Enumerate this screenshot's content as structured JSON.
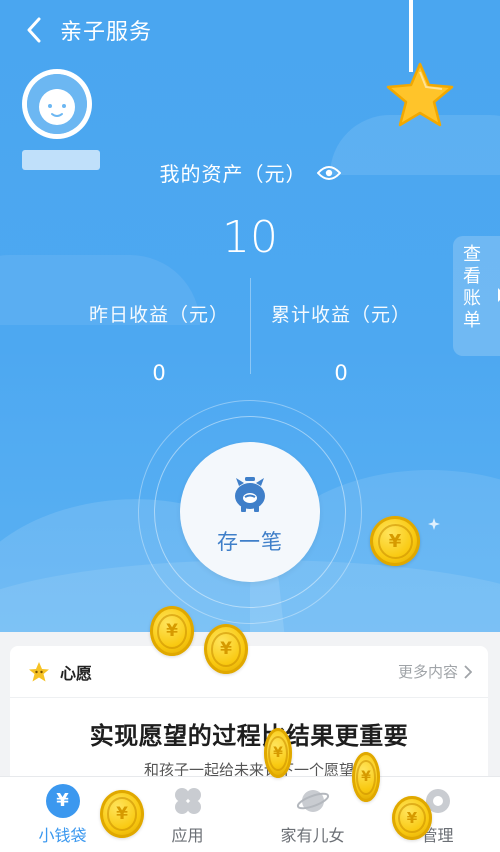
{
  "header": {
    "title": "亲子服务"
  },
  "assets": {
    "label": "我的资产（元）",
    "value": "10",
    "yesterday_label": "昨日收益（元）",
    "yesterday_value": "0",
    "total_label": "累计收益（元）",
    "total_value": "0"
  },
  "bill_button": {
    "label": "查看账单"
  },
  "save_button": {
    "label": "存一笔"
  },
  "wish": {
    "title": "心愿",
    "more": "更多内容",
    "headline": "实现愿望的过程比结果更重要",
    "subline": "和孩子一起给未来许下一个愿望"
  },
  "tabs": [
    {
      "label": "小钱袋",
      "icon": "yen-wallet-icon",
      "active": true
    },
    {
      "label": "应用",
      "icon": "apps-clover-icon",
      "active": false
    },
    {
      "label": "家有儿女",
      "icon": "planet-icon",
      "active": false
    },
    {
      "label": "管理",
      "icon": "manage-icon",
      "active": false
    }
  ],
  "colors": {
    "primary": "#4aa6f0",
    "accent_text": "#3f7fc9",
    "coin": "#f9c910",
    "star": "#ffc42a"
  }
}
